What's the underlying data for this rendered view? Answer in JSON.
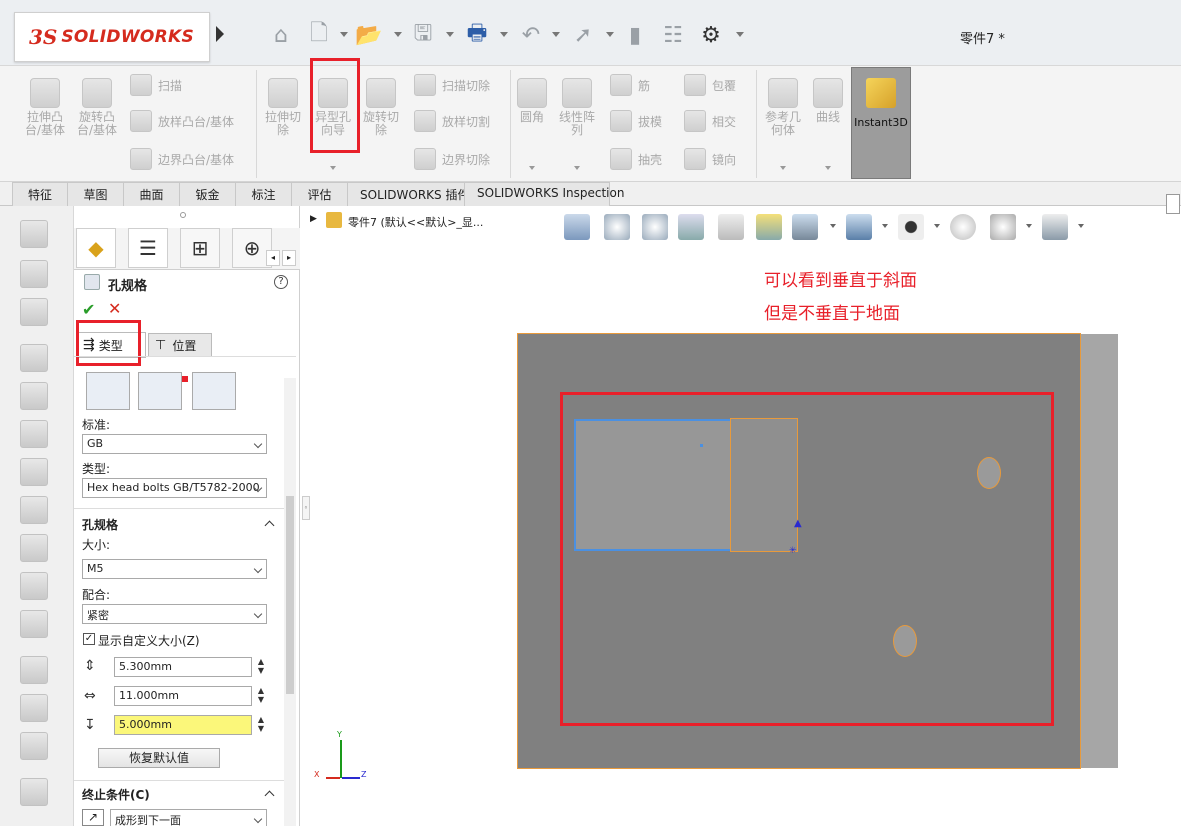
{
  "app": {
    "logo_ds": "3S",
    "logo_text": "SOLIDWORKS",
    "window_title": "零件7 *"
  },
  "quick_access": {
    "icons": [
      "home-icon",
      "new-document-icon",
      "open-icon",
      "save-icon",
      "print-icon",
      "undo-icon",
      "select-icon",
      "rebuild-icon",
      "file-properties-icon",
      "options-icon"
    ]
  },
  "ribbon": {
    "extruded_boss": "拉伸凸\n台/基体",
    "revolved_boss": "旋转凸\n台/基体",
    "swept_boss": "扫描",
    "lofted_boss": "放样凸台/基体",
    "boundary_boss": "边界凸台/基体",
    "extruded_cut": "拉伸切\n除",
    "hole_wizard": "异型孔\n向导",
    "revolved_cut": "旋转切\n除",
    "swept_cut": "扫描切除",
    "lofted_cut": "放样切割",
    "boundary_cut": "边界切除",
    "fillet": "圆角",
    "linear_pattern": "线性阵\n列",
    "rib": "筋",
    "draft": "拔模",
    "shell": "抽壳",
    "wrap": "包覆",
    "intersect": "相交",
    "mirror": "镜向",
    "ref_geometry": "参考几\n何体",
    "curves": "曲线",
    "instant3d": "Instant3D"
  },
  "tabs": [
    "特征",
    "草图",
    "曲面",
    "钣金",
    "标注",
    "评估",
    "SOLIDWORKS 插件",
    "SOLIDWORKS Inspection"
  ],
  "property_manager": {
    "title": "孔规格",
    "ok_icon": "check-icon",
    "cancel_icon": "close-icon",
    "subtab_type": "类型",
    "subtab_position": "位置",
    "standard_label": "标准:",
    "standard_value": "GB",
    "type_label": "类型:",
    "type_value": "Hex head bolts GB/T5782-2000",
    "spec_section": "孔规格",
    "size_label": "大小:",
    "size_value": "M5",
    "fit_label": "配合:",
    "fit_value": "紧密",
    "show_custom_sizing": "显示自定义大小(Z)",
    "through_diameter": "5.300mm",
    "cbore_diameter": "11.000mm",
    "cbore_depth": "5.000mm",
    "restore_defaults": "恢复默认值",
    "end_condition_section": "终止条件(C)",
    "end_condition_value": "成形到下一面"
  },
  "feature_tree": {
    "item": "零件7  (默认<<默认>_显..."
  },
  "annotation": {
    "line1": "可以看到垂直于斜面",
    "line2": "但是不垂直于地面"
  },
  "triad": {
    "y": "Y",
    "x": "X",
    "z": "Z"
  },
  "colors": {
    "annotation_red": "#e8202a",
    "model_face": "#808080",
    "model_edge": "#e89a3c",
    "sketch_blue": "#4a90e2"
  }
}
